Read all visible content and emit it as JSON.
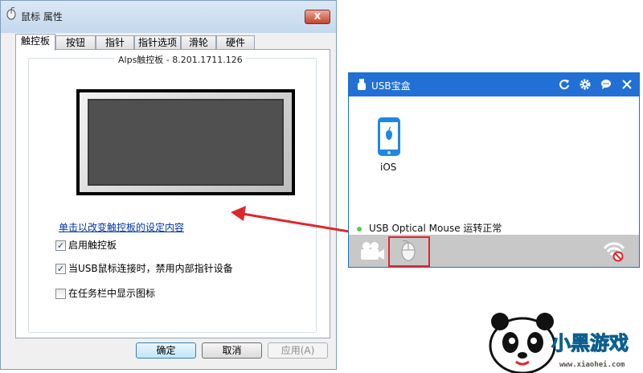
{
  "dialog": {
    "title": "鼠标 属性",
    "close_label": "X",
    "tabs": [
      {
        "label": "触控板",
        "active": true
      },
      {
        "label": "按钮",
        "active": false
      },
      {
        "label": "指针",
        "active": false
      },
      {
        "label": "指针选项",
        "active": false
      },
      {
        "label": "滑轮",
        "active": false
      },
      {
        "label": "硬件",
        "active": false
      }
    ],
    "group_title": "Alps触控板 - 8.201.1711.126",
    "settings_link": "单击以改变触控板的设定内容",
    "checkboxes": [
      {
        "label": "启用触控板",
        "checked": true,
        "mark": "✓"
      },
      {
        "label": "当USB鼠标连接时，禁用内部指针设备",
        "checked": true,
        "mark": "✓"
      },
      {
        "label": "在任务栏中显示图标",
        "checked": false,
        "mark": ""
      }
    ],
    "buttons": {
      "ok": "确定",
      "cancel": "取消",
      "apply": "应用(A)"
    }
  },
  "usb_box": {
    "title": "USB宝盒",
    "device_label": "iOS",
    "status": "USB Optical Mouse 运转正常",
    "colors": {
      "header": "#2270d5",
      "highlight": "#e0262b",
      "status_dot": "#55cc55"
    }
  },
  "watermark": {
    "logo_text": "小黑游戏",
    "url": "www.xiaohei.com"
  }
}
